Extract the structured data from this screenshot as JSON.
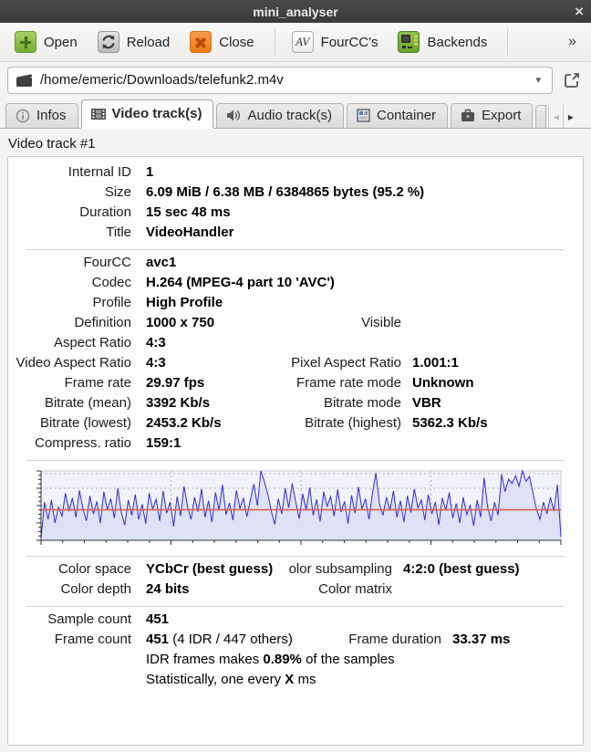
{
  "window": {
    "title": "mini_analyser",
    "close_label": "×"
  },
  "toolbar": {
    "items": [
      {
        "label": "Open",
        "icon": "open-plus-icon"
      },
      {
        "label": "Reload",
        "icon": "reload-icon"
      },
      {
        "label": "Close",
        "icon": "close-file-icon"
      },
      {
        "label": "FourCC's",
        "icon": "av-badge-icon",
        "badge_text": "AV"
      },
      {
        "label": "Backends",
        "icon": "chip-icon"
      }
    ],
    "overflow_label": "»"
  },
  "address_bar": {
    "path": "/home/emeric/Downloads/telefunk2.m4v",
    "dropdown_glyph": "▾"
  },
  "tabs": {
    "items": [
      {
        "label": "Infos",
        "icon": "info-icon",
        "selected": false
      },
      {
        "label": "Video track(s)",
        "icon": "film-icon",
        "selected": true
      },
      {
        "label": "Audio track(s)",
        "icon": "speaker-icon",
        "selected": false
      },
      {
        "label": "Container",
        "icon": "container-icon",
        "selected": false
      },
      {
        "label": "Export",
        "icon": "export-icon",
        "selected": false
      }
    ],
    "scroll_left_glyph": "◂",
    "scroll_right_glyph": "▸"
  },
  "main": {
    "section_title": "Video track #1",
    "sections": [
      {
        "id": "identity",
        "rows": [
          {
            "label": "Internal ID",
            "value": [
              {
                "t": "1",
                "b": true
              }
            ]
          },
          {
            "label": "Size",
            "value": [
              {
                "t": "6.09 MiB  /  6.38 MB  /  6384865 bytes (95.2 %)",
                "b": true
              }
            ]
          },
          {
            "label": "Duration",
            "value": [
              {
                "t": "15 sec 48 ms",
                "b": true
              }
            ]
          },
          {
            "label": "Title",
            "value": [
              {
                "t": "VideoHandler",
                "b": true
              }
            ]
          }
        ]
      },
      {
        "id": "codec",
        "rows": [
          {
            "label": "FourCC",
            "value": [
              {
                "t": "avc1",
                "b": true
              }
            ]
          },
          {
            "label": "Codec",
            "value": [
              {
                "t": "H.264 (MPEG-4 part 10 'AVC')",
                "b": true
              }
            ]
          },
          {
            "label": "Profile",
            "value": [
              {
                "t": "High Profile",
                "b": true
              }
            ]
          },
          {
            "label": "Definition",
            "value": [
              {
                "t": "1000 x 750",
                "b": true
              }
            ],
            "label2": "Visible",
            "value2": []
          },
          {
            "label": "Aspect Ratio",
            "value": [
              {
                "t": "4:3",
                "b": true
              }
            ]
          },
          {
            "label": "Video Aspect Ratio",
            "value": [
              {
                "t": "4:3",
                "b": true
              }
            ],
            "label2": "Pixel Aspect Ratio",
            "value2": [
              {
                "t": "1.001:1",
                "b": true
              }
            ]
          },
          {
            "label": "Frame rate",
            "value": [
              {
                "t": "29.97 fps",
                "b": true
              }
            ],
            "label2": "Frame rate mode",
            "value2": [
              {
                "t": "Unknown",
                "b": true
              }
            ]
          },
          {
            "label": "Bitrate (mean)",
            "value": [
              {
                "t": "3392 Kb/s",
                "b": true
              }
            ],
            "label2": "Bitrate mode",
            "value2": [
              {
                "t": "VBR",
                "b": true
              }
            ]
          },
          {
            "label": "Bitrate (lowest)",
            "value": [
              {
                "t": "2453.2 Kb/s",
                "b": true
              }
            ],
            "label2": "Bitrate (highest)",
            "value2": [
              {
                "t": "5362.3 Kb/s",
                "b": true
              }
            ]
          },
          {
            "label": "Compress. ratio",
            "value": [
              {
                "t": "159:1",
                "b": true
              }
            ]
          }
        ]
      },
      {
        "id": "chart"
      },
      {
        "id": "color",
        "rows": [
          {
            "label": "Color space",
            "value": [
              {
                "t": "YCbCr (best guess)",
                "b": true
              }
            ],
            "label2": "olor subsampling",
            "value2": [
              {
                "t": "4:2:0 (best guess)",
                "b": true
              }
            ]
          },
          {
            "label": "Color depth",
            "value": [
              {
                "t": "24 bits",
                "b": true
              }
            ],
            "label2": "Color matrix",
            "value2": []
          }
        ]
      },
      {
        "id": "samples",
        "rows": [
          {
            "label": "Sample count",
            "value": [
              {
                "t": "451",
                "b": true
              }
            ]
          },
          {
            "label": "Frame count",
            "value": [
              {
                "t": "451",
                "b": true
              },
              {
                "t": " (4 IDR / 447 others)",
                "b": false
              }
            ],
            "label2": "Frame duration",
            "value2": [
              {
                "t": "33.37 ms",
                "b": true
              }
            ]
          },
          {
            "label": "",
            "value": [
              {
                "t": "IDR frames makes ",
                "b": false
              },
              {
                "t": "0.89%",
                "b": true
              },
              {
                "t": " of the samples",
                "b": false
              }
            ]
          },
          {
            "label": "",
            "value": [
              {
                "t": "Statistically, one every ",
                "b": false
              },
              {
                "t": "X",
                "b": true
              },
              {
                "t": " ms",
                "b": false
              }
            ]
          }
        ]
      }
    ]
  },
  "chart_data": {
    "type": "area",
    "description": "Per-sample video bitrate over the track (axes unlabeled in UI)",
    "x_range_samples": [
      0,
      451
    ],
    "y_range_kbps": [
      2453.2,
      5362.3
    ],
    "mean_kbps": 3392,
    "mean_line_normalized": 0.44,
    "line_color": "#2d2dcb",
    "fill_color": "#dcdef5",
    "plot_bg_color": "#f1f2fa",
    "mean_line_color": "#d4604e",
    "grid_on": true,
    "points_normalized": [
      0.02,
      0.55,
      0.3,
      0.58,
      0.25,
      0.48,
      0.35,
      0.68,
      0.42,
      0.61,
      0.33,
      0.72,
      0.46,
      0.28,
      0.64,
      0.38,
      0.56,
      0.25,
      0.7,
      0.44,
      0.6,
      0.32,
      0.75,
      0.4,
      0.22,
      0.58,
      0.36,
      0.66,
      0.3,
      0.52,
      0.24,
      0.68,
      0.45,
      0.59,
      0.28,
      0.71,
      0.39,
      0.55,
      0.2,
      0.63,
      0.35,
      0.78,
      0.48,
      0.3,
      0.62,
      0.41,
      0.74,
      0.33,
      0.57,
      0.26,
      0.69,
      0.43,
      0.8,
      0.37,
      0.54,
      0.29,
      0.72,
      0.46,
      0.61,
      0.34,
      0.58,
      0.81,
      0.5,
      1.0,
      0.85,
      0.66,
      0.42,
      0.23,
      0.6,
      0.38,
      0.75,
      0.47,
      0.82,
      0.55,
      0.31,
      0.67,
      0.44,
      0.76,
      0.36,
      0.59,
      0.27,
      0.7,
      0.49,
      0.63,
      0.35,
      0.73,
      0.41,
      0.56,
      0.24,
      0.65,
      0.39,
      0.77,
      0.45,
      0.6,
      0.3,
      0.68,
      0.97,
      0.52,
      0.36,
      0.62,
      0.43,
      0.71,
      0.33,
      0.57,
      0.26,
      0.64,
      0.4,
      0.74,
      0.47,
      0.58,
      0.29,
      0.66,
      0.38,
      0.55,
      0.22,
      0.61,
      0.44,
      0.69,
      0.32,
      0.53,
      0.25,
      0.62,
      0.37,
      0.5,
      0.21,
      0.58,
      0.33,
      0.9,
      0.48,
      0.28,
      0.55,
      0.36,
      0.95,
      0.7,
      0.88,
      0.82,
      0.93,
      0.78,
      1.0,
      0.85,
      0.92,
      0.68,
      0.45,
      0.3,
      0.55,
      0.38,
      0.62,
      0.42,
      0.8,
      0.05
    ]
  }
}
